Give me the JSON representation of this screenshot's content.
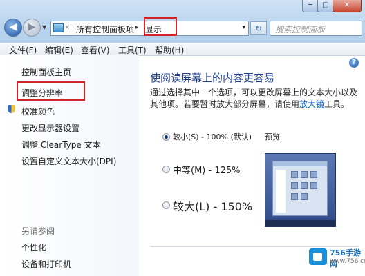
{
  "window_controls": {
    "minimize": "─",
    "maximize": "□",
    "close": "✕"
  },
  "address_bar": {
    "separator": "«",
    "crumbs": [
      "所有控制面板项",
      "显示"
    ],
    "crumb_arrow": "▸",
    "dropdown": "▾",
    "refresh": "↻"
  },
  "search": {
    "placeholder": "搜索控制面板"
  },
  "menubar": {
    "items": [
      "文件(F)",
      "编辑(E)",
      "查看(V)",
      "工具(T)",
      "帮助(H)"
    ]
  },
  "sidebar": {
    "links": [
      "控制面板主页",
      "调整分辨率",
      "校准颜色",
      "更改显示器设置",
      "调整 ClearType 文本",
      "设置自定义文本大小(DPI)"
    ],
    "see_also_heading": "另请参阅",
    "see_also": [
      "个性化",
      "设备和打印机"
    ]
  },
  "content": {
    "heading": "使阅读屏幕上的内容更容易",
    "desc_line1": "通过选择其中一个选项，可以更改屏幕上的文本大小以及",
    "desc_line2_prefix": "其他项。若要暂时放大部分屏幕，请使用",
    "magnifier_link": "放大镜",
    "desc_line2_suffix": "工具。",
    "options": [
      {
        "label": "较小(S) - 100% (默认)",
        "selected": true
      },
      {
        "label": "中等(M) - 125%",
        "selected": false
      },
      {
        "label": "较大(L) - 150%",
        "selected": false
      }
    ],
    "preview_label": "预览"
  },
  "watermark": {
    "name": "756手游网",
    "url": "www.756.com"
  },
  "colors": {
    "heading": "#1e3f8f",
    "link": "#0b58c4",
    "highlight": "#d1232a"
  }
}
